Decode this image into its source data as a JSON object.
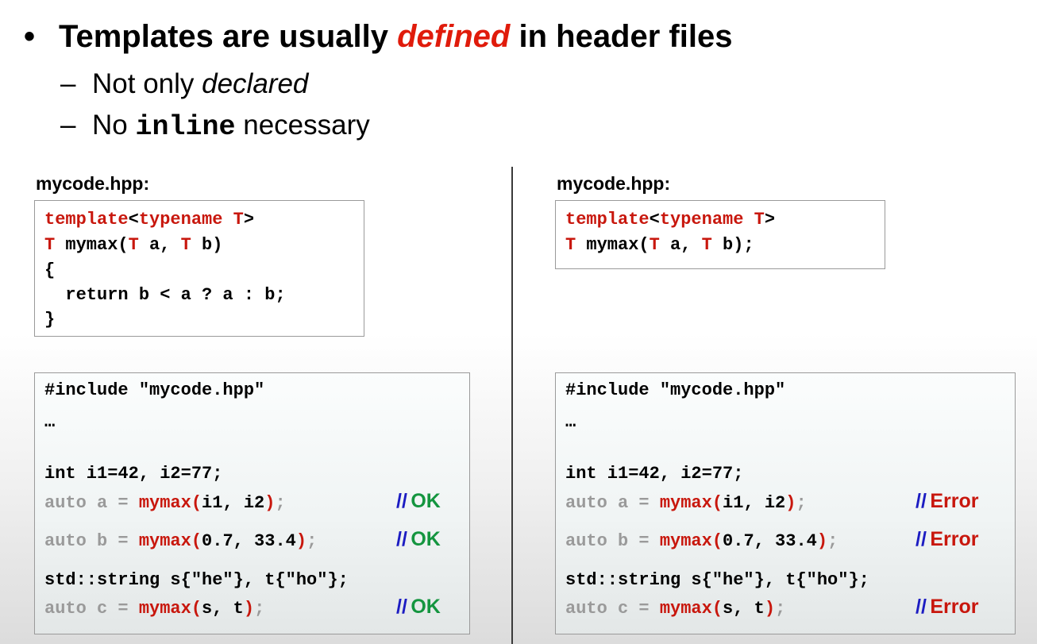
{
  "slide": {
    "bullet": {
      "glyph": "•",
      "before": "Templates are usually ",
      "emphasis": "defined",
      "after": " in header files"
    },
    "sub1": {
      "dash": "–",
      "text": "Not only ",
      "italic": "declared"
    },
    "sub2": {
      "dash": "–",
      "before": "No ",
      "code": "inline",
      "after": " necessary"
    }
  },
  "left": {
    "header_label": "mycode.hpp:",
    "header_code": {
      "l1_kw1": "template",
      "l1_p1": "<",
      "l1_kw2": "typename",
      "l1_sp": " ",
      "l1_kw3": "T",
      "l1_p2": ">",
      "l2_kw1": "T",
      "l2_p1": " mymax(",
      "l2_kw2": "T",
      "l2_p2": " a, ",
      "l2_kw3": "T",
      "l2_p3": " b)",
      "l3": "{",
      "l4": "  return b < a ? a : b;",
      "l5": "}"
    },
    "usage": {
      "include": "#include \"mycode.hpp\"",
      "ellipsis": "…",
      "ints": "int i1=42, i2=77;",
      "a_pre": "auto a = ",
      "a_fn": "mymax(",
      "a_args": "i1, i2",
      "a_close": ")",
      "a_semi": ";",
      "b_pre": "auto b = ",
      "b_fn": "mymax(",
      "b_args": "0.7, 33.4",
      "b_close": ")",
      "b_semi": ";",
      "strings": "std::string s{\"he\"}, t{\"ho\"};",
      "c_pre": "auto c = ",
      "c_fn": "mymax(",
      "c_args": "s, t",
      "c_close": ")",
      "c_semi": ";",
      "comment_slashes": "//",
      "result_a": "OK",
      "result_b": "OK",
      "result_c": "OK"
    }
  },
  "right": {
    "header_label": "mycode.hpp:",
    "header_code": {
      "l1_kw1": "template",
      "l1_p1": "<",
      "l1_kw2": "typename",
      "l1_sp": " ",
      "l1_kw3": "T",
      "l1_p2": ">",
      "l2_kw1": "T",
      "l2_p1": " mymax(",
      "l2_kw2": "T",
      "l2_p2": " a, ",
      "l2_kw3": "T",
      "l2_p3": " b);"
    },
    "usage": {
      "include": "#include \"mycode.hpp\"",
      "ellipsis": "…",
      "ints": "int i1=42, i2=77;",
      "a_pre": "auto a = ",
      "a_fn": "mymax(",
      "a_args": "i1, i2",
      "a_close": ")",
      "a_semi": ";",
      "b_pre": "auto b = ",
      "b_fn": "mymax(",
      "b_args": "0.7, 33.4",
      "b_close": ")",
      "b_semi": ";",
      "strings": "std::string s{\"he\"}, t{\"ho\"};",
      "c_pre": "auto c = ",
      "c_fn": "mymax(",
      "c_args": "s, t",
      "c_close": ")",
      "c_semi": ";",
      "comment_slashes": "//",
      "result_a": "Error",
      "result_b": "Error",
      "result_c": "Error"
    }
  },
  "colors": {
    "emphasis_red": "#e01b0b",
    "keyword_red": "#c8170d",
    "ok_green": "#14953f",
    "comment_blue": "#1c1cc2",
    "dim_grey": "#9a9a9a"
  }
}
